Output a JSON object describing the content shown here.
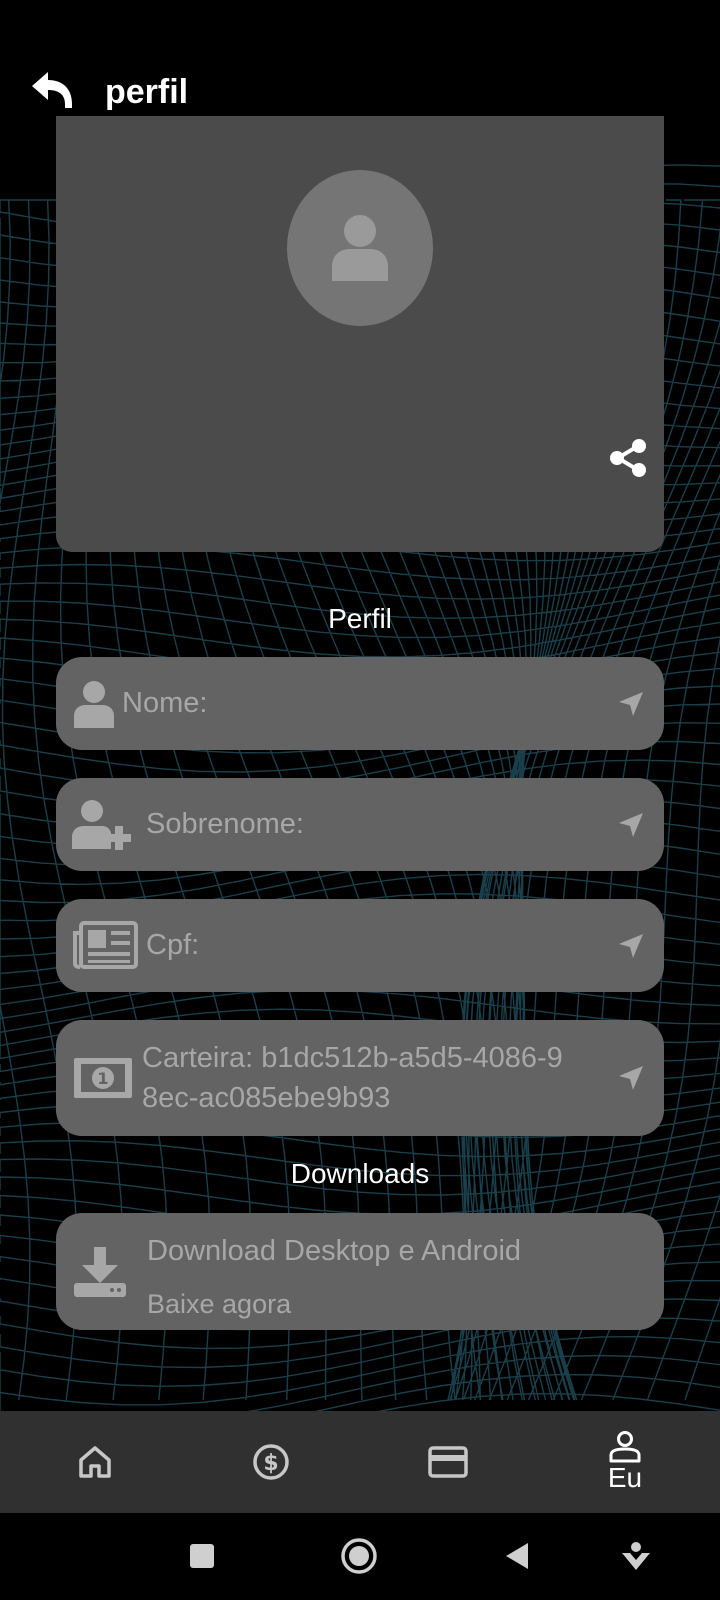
{
  "header": {
    "title": "perfil",
    "back_icon": "back-arrow-icon"
  },
  "profile_card": {
    "avatar_icon": "user-icon",
    "share_icon": "share-icon"
  },
  "sections": {
    "profile_title": "Perfil",
    "downloads_title": "Downloads"
  },
  "fields": [
    {
      "icon": "user-icon",
      "label": "Nome:"
    },
    {
      "icon": "user-plus-icon",
      "label": "Sobrenome:"
    },
    {
      "icon": "newspaper-icon",
      "label": "Cpf:"
    },
    {
      "icon": "money-bill-icon",
      "label_line1": "Carteira: b1dc512b-a5d5-4086-9",
      "label_line2": "8ec-ac085ebe9b93"
    }
  ],
  "download": {
    "icon": "download-icon",
    "title": "Download Desktop e Android",
    "subtitle": "Baixe agora"
  },
  "bottom_nav": [
    {
      "icon": "home-icon"
    },
    {
      "icon": "dollar-circle-icon"
    },
    {
      "icon": "card-icon"
    },
    {
      "icon": "person-icon",
      "label": "Eu"
    }
  ],
  "system_nav": [
    "recents-square-icon",
    "home-circle-icon",
    "back-triangle-icon",
    "assistant-icon"
  ],
  "colors": {
    "card": "#4b4b4b",
    "row": "#636363",
    "nav": "#303030",
    "text_muted": "#a7a7a7",
    "grid_lines": "#1f4a57"
  }
}
